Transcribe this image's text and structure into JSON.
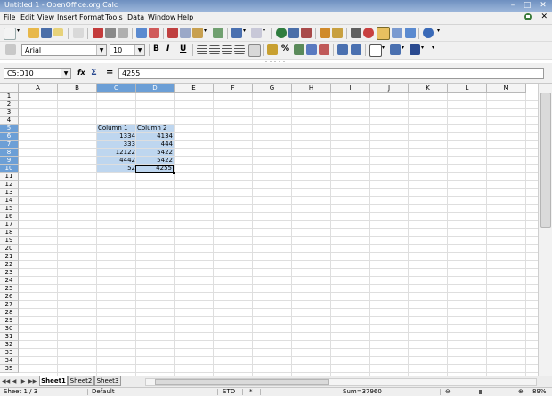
{
  "window": {
    "title": "Untitled 1 - OpenOffice.org Calc"
  },
  "menu": [
    {
      "id": "file",
      "label": "File"
    },
    {
      "id": "edit",
      "label": "Edit"
    },
    {
      "id": "view",
      "label": "View"
    },
    {
      "id": "insert",
      "label": "Insert"
    },
    {
      "id": "format",
      "label": "Format"
    },
    {
      "id": "tools",
      "label": "Tools"
    },
    {
      "id": "data",
      "label": "Data"
    },
    {
      "id": "window",
      "label": "Window"
    },
    {
      "id": "help",
      "label": "Help"
    }
  ],
  "formatting": {
    "font_name": "Arial",
    "font_size": "10",
    "bold": "B",
    "italic": "I",
    "underline": "U",
    "percent": "%"
  },
  "formula_bar": {
    "name_box": "C5:D10",
    "fx": "fx",
    "sum": "Σ",
    "equals": "=",
    "content": "4255"
  },
  "sheet": {
    "columns": [
      "A",
      "B",
      "C",
      "D",
      "E",
      "F",
      "G",
      "H",
      "I",
      "J",
      "K",
      "L",
      "M"
    ],
    "rows": [
      "1",
      "2",
      "3",
      "4",
      "5",
      "6",
      "7",
      "8",
      "9",
      "10",
      "11",
      "12",
      "13",
      "14",
      "15",
      "16",
      "17",
      "18",
      "19",
      "20",
      "21",
      "22",
      "23",
      "24",
      "25",
      "26",
      "27",
      "28",
      "29",
      "30",
      "31",
      "32",
      "33",
      "34",
      "35"
    ],
    "selected_columns": [
      "C",
      "D"
    ],
    "selected_rows": [
      "5",
      "6",
      "7",
      "8",
      "9",
      "10"
    ],
    "cells": {
      "C5": "Column 1",
      "D5": "Column 2",
      "C6": "1334",
      "D6": "4134",
      "C7": "333",
      "D7": "444",
      "C8": "12122",
      "D8": "5422",
      "C9": "4442",
      "D9": "5422",
      "C10": "52",
      "D10": "4255"
    },
    "tabs": [
      "Sheet1",
      "Sheet2",
      "Sheet3"
    ],
    "active_tab": "Sheet1"
  },
  "status": {
    "sheet": "Sheet 1 / 3",
    "style": "Default",
    "mode": "STD",
    "modified": "*",
    "sum": "Sum=37960",
    "zoom": "89%"
  },
  "colors": {
    "selection": "#bed6ef",
    "header_selected": "#6c9fd6",
    "titlebar": "#7c9cc8"
  }
}
